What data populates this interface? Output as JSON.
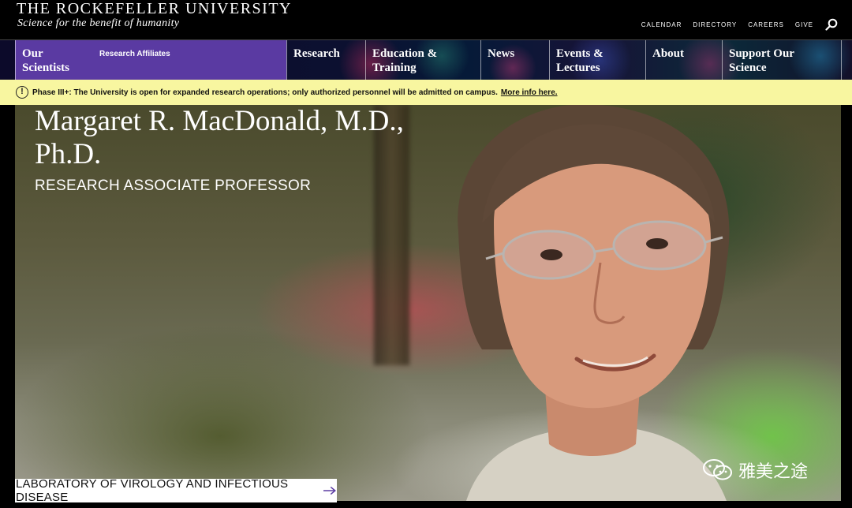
{
  "header": {
    "logo_title": "THE ROCKEFELLER UNIVERSITY",
    "tagline": "Science for the benefit of humanity",
    "utility_links": [
      "CALENDAR",
      "DIRECTORY",
      "CAREERS",
      "GIVE"
    ],
    "search_icon": "search-icon"
  },
  "nav": {
    "active": {
      "label_line1": "Our",
      "label_line2": "Scientists",
      "sub_label": "Research Affiliates"
    },
    "items": [
      {
        "line1": "Research",
        "line2": ""
      },
      {
        "line1": "Education &",
        "line2": "Training"
      },
      {
        "line1": "News",
        "line2": ""
      },
      {
        "line1": "Events &",
        "line2": "Lectures"
      },
      {
        "line1": "About",
        "line2": ""
      },
      {
        "line1": "Support Our",
        "line2": "Science"
      }
    ],
    "active_color": "#5a3aa2"
  },
  "alert": {
    "icon": "!",
    "text": "Phase III+: The University is open for expanded research operations; only authorized personnel will be admitted on campus.",
    "link": "More info here.",
    "background": "#f8f6a0"
  },
  "hero": {
    "name_line1": "Margaret R. MacDonald, M.D.,",
    "name_line2": "Ph.D.",
    "role": "RESEARCH ASSOCIATE PROFESSOR",
    "lab_link": "LABORATORY OF VIROLOGY AND INFECTIOUS DISEASE"
  },
  "watermark": {
    "text": "雅美之途"
  }
}
